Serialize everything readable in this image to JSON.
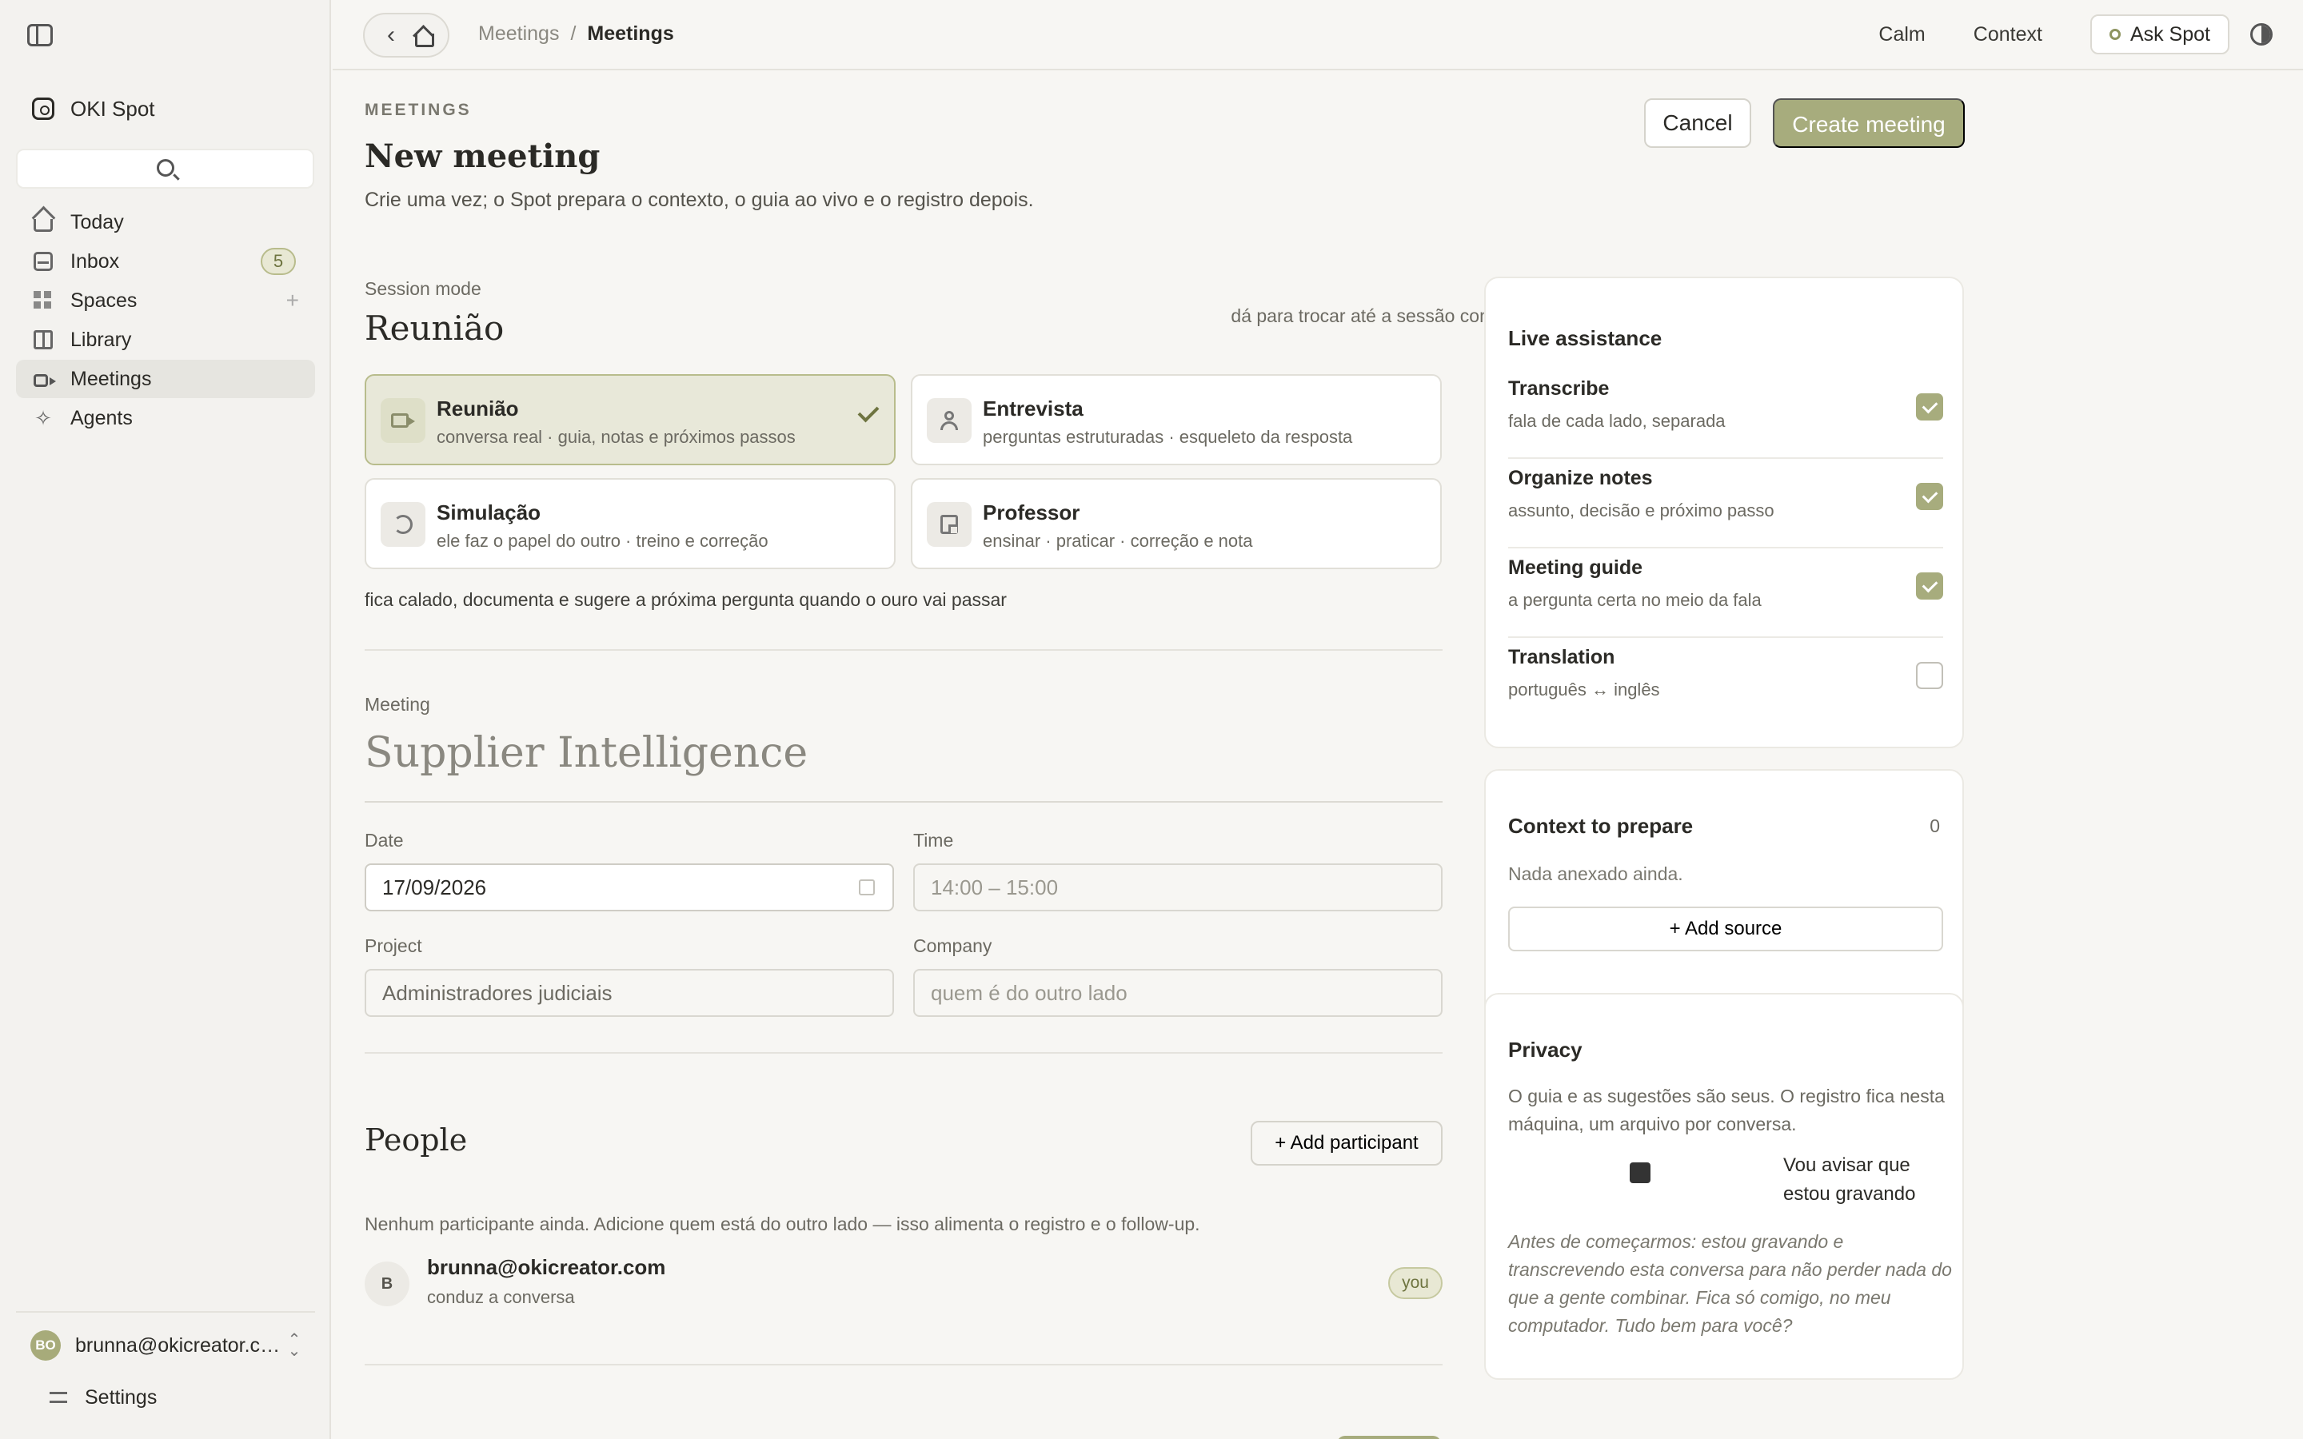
{
  "app": {
    "name": "OKI Spot"
  },
  "sidebar": {
    "items": [
      {
        "label": "Today",
        "icon": "home-icon"
      },
      {
        "label": "Inbox",
        "icon": "inbox-icon",
        "badge": "5"
      },
      {
        "label": "Spaces",
        "icon": "grid-icon",
        "add": "+"
      },
      {
        "label": "Library",
        "icon": "book-icon"
      },
      {
        "label": "Meetings",
        "icon": "video-icon",
        "active": true
      },
      {
        "label": "Agents",
        "icon": "sparkle-icon"
      }
    ],
    "user": {
      "initials": "BO",
      "email": "brunna@okicreator.com"
    },
    "settings_label": "Settings"
  },
  "topbar": {
    "breadcrumb": [
      "Meetings",
      "/",
      "Meetings"
    ],
    "calm": "Calm",
    "context": "Context",
    "ask": "Ask Spot"
  },
  "page": {
    "eyebrow": "MEETINGS",
    "title": "New meeting",
    "subtitle": "Crie uma vez; o Spot prepara o contexto, o guia ao vivo e o registro depois.",
    "cancel": "Cancel",
    "create": "Create meeting"
  },
  "session": {
    "label": "Session mode",
    "title": "Reunião",
    "hint": "dá para trocar até a sessão começar",
    "modes": [
      {
        "name": "Reunião",
        "desc": "conversa real · guia, notas e próximos passos",
        "icon": "video-icon",
        "selected": true
      },
      {
        "name": "Entrevista",
        "desc": "perguntas estruturadas · esqueleto da resposta",
        "icon": "person-icon"
      },
      {
        "name": "Simulação",
        "desc": "ele faz o papel do outro · treino e correção",
        "icon": "reload-icon"
      },
      {
        "name": "Professor",
        "desc": "ensinar · praticar · correção e nota",
        "icon": "note-icon"
      }
    ],
    "note": "fica calado, documenta e sugere a próxima pergunta quando o ouro vai passar"
  },
  "meeting": {
    "label": "Meeting",
    "title_placeholder": "Supplier Intelligence",
    "date_label": "Date",
    "date_value": "17/09/2026",
    "time_label": "Time",
    "time_placeholder": "14:00 – 15:00",
    "project_label": "Project",
    "project_placeholder": "Administradores judiciais",
    "company_label": "Company",
    "company_placeholder": "quem é do outro lado"
  },
  "people": {
    "title": "People",
    "add": "+ Add participant",
    "note": "Nenhum participante ainda. Adicione quem está do outro lado — isso alimenta o registro e o follow-up.",
    "person": {
      "initial": "B",
      "email": "brunna@okicreator.com",
      "role": "conduz a conversa",
      "badge": "you"
    }
  },
  "live": {
    "title": "Live assistance",
    "items": [
      {
        "name": "Transcribe",
        "desc": "fala de cada lado, separada",
        "checked": true
      },
      {
        "name": "Organize notes",
        "desc": "assunto, decisão e próximo passo",
        "checked": true
      },
      {
        "name": "Meeting guide",
        "desc": "a pergunta certa no meio da fala",
        "checked": true
      },
      {
        "name": "Translation",
        "desc": "português ↔ inglês",
        "checked": false
      }
    ]
  },
  "context": {
    "title": "Context to prepare",
    "count": "0",
    "empty": "Nada anexado ainda.",
    "add": "+ Add source"
  },
  "privacy": {
    "title": "Privacy",
    "text": "O guia e as sugestões são seus. O registro fica nesta máquina, um arquivo por conversa.",
    "toggle_label": "Vou avisar que estou gravando",
    "quote": "Antes de começarmos: estou gravando e transcrevendo esta conversa para não perder nada do que a gente combinar. Fica só comigo, no meu computador. Tudo bem para você?"
  }
}
